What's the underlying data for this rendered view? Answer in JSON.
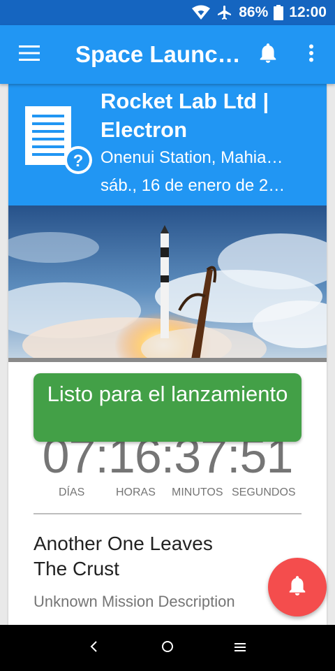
{
  "status_bar": {
    "battery": "86%",
    "time": "12:00"
  },
  "app_bar": {
    "title": "Space Launc…"
  },
  "launch": {
    "title": "Rocket Lab Ltd | Electron",
    "location": "Onenui Station, Mahia…",
    "date": "sáb., 16 de enero de 2…",
    "status": "Listo para el lanzamiento",
    "countdown": "07:16:37:51",
    "labels": {
      "days": "DÍAS",
      "hours": "HORAS",
      "minutes": "MINUTOS",
      "seconds": "SEGUNDOS"
    },
    "mission_name": "Another One Leaves The Crust",
    "mission_description": "Unknown Mission Description"
  },
  "colors": {
    "primary": "#2196f3",
    "primary_dark": "#1565c0",
    "status_green": "#43a047",
    "fab_red": "#f44d4d"
  },
  "icons": {
    "status": [
      "wifi-icon",
      "airplane-mode-icon",
      "battery-icon"
    ],
    "app_bar": [
      "hamburger-menu-icon",
      "bell-icon",
      "more-vert-icon"
    ],
    "card": "document-question-icon",
    "nav": [
      "back-icon",
      "home-icon",
      "recents-icon"
    ]
  }
}
